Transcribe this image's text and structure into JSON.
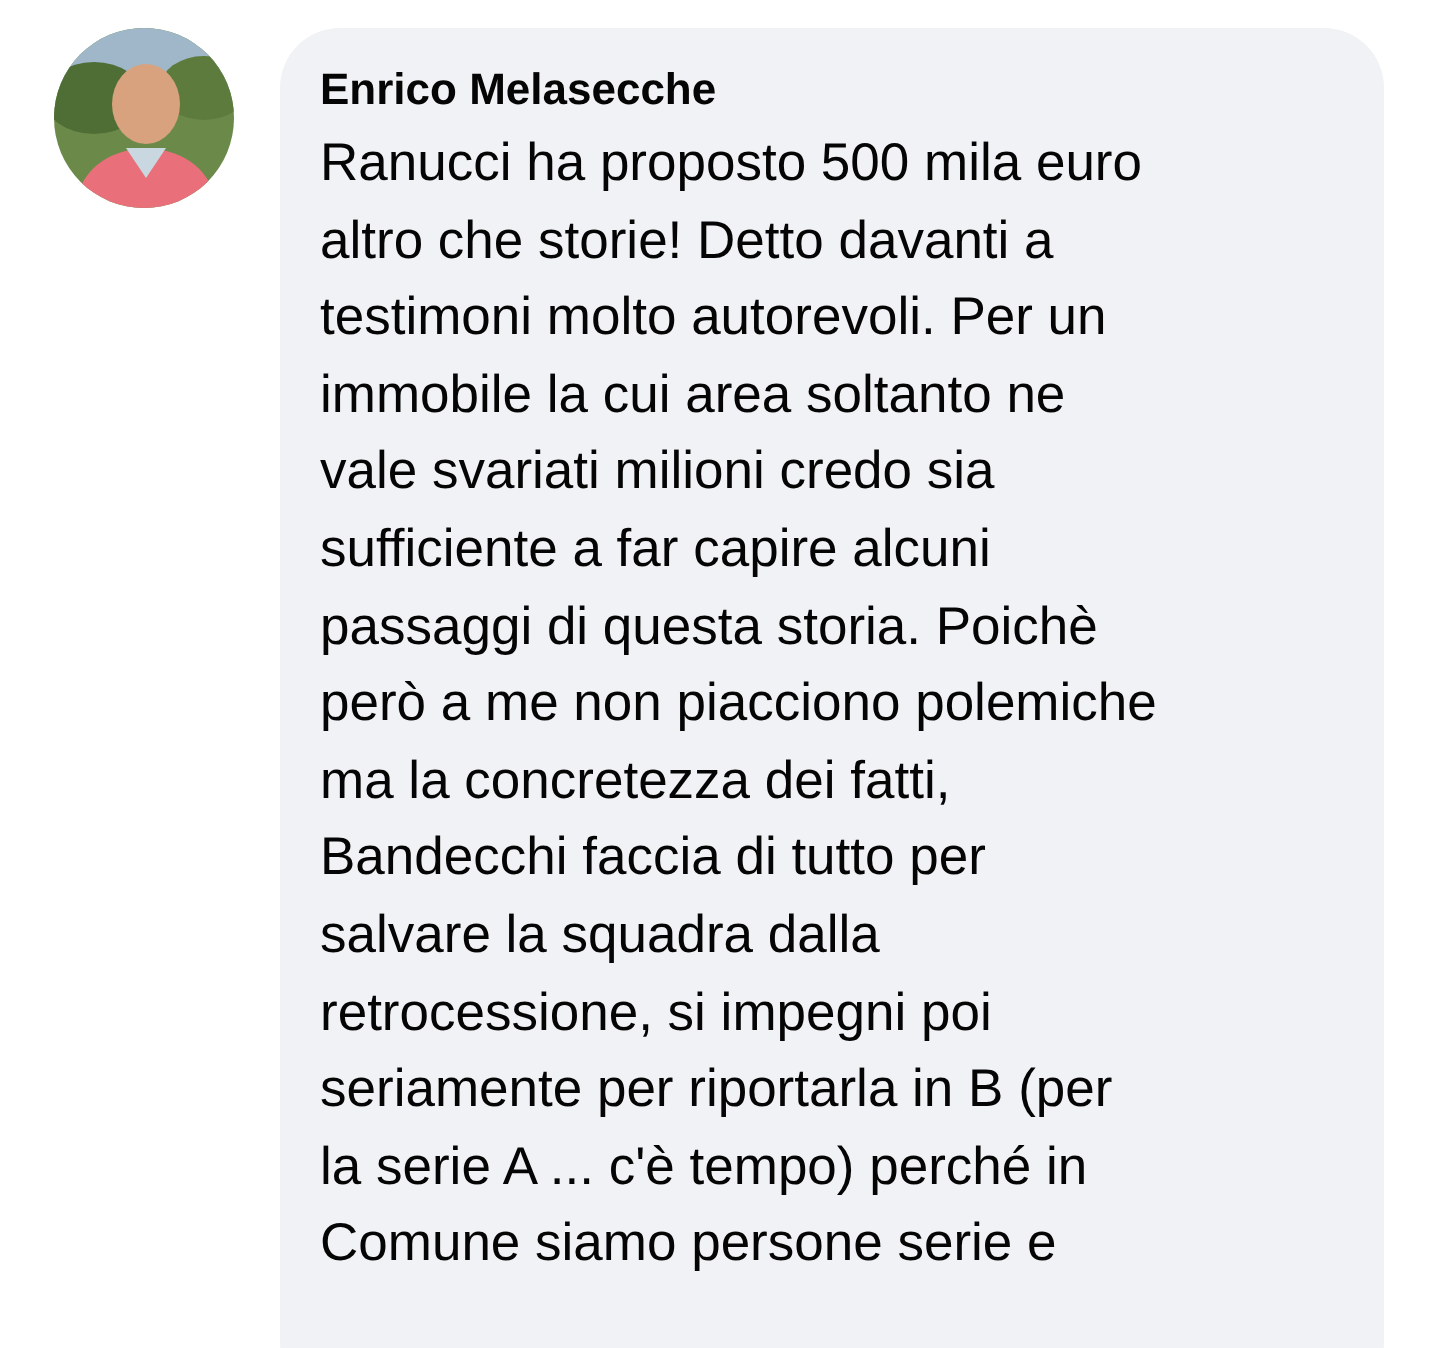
{
  "comment": {
    "author": "Enrico Melasecche",
    "text": "Ranucci ha proposto 500 mila euro\naltro che storie! Detto davanti a\ntestimoni molto autorevoli. Per un\nimmobile la cui area soltanto ne\nvale svariati milioni credo sia\nsufficiente a far capire alcuni\npassaggi di questa storia. Poichè\nperò a me non piacciono polemiche\nma la concretezza dei fatti,\nBandecchi faccia di tutto per\nsalvare la squadra dalla\nretrocessione, si impegni poi\nseriamente per riportarla in B (per\nla serie A ... c'è tempo) perché in\nComune siamo persone serie e"
  }
}
